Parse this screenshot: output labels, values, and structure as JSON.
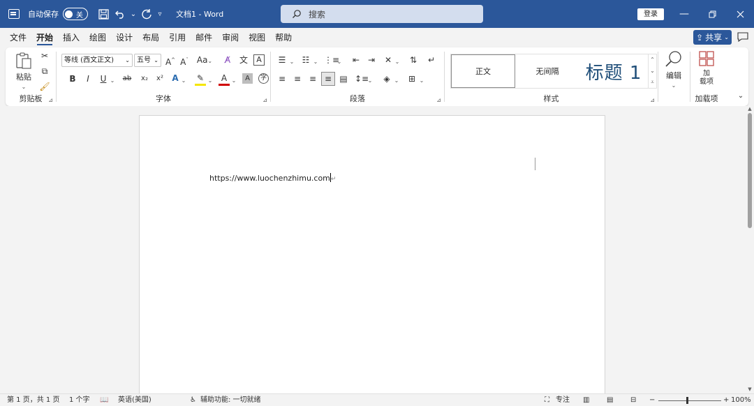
{
  "titlebar": {
    "autosave_label": "自动保存",
    "autosave_state": "关",
    "doc_title": "文档1  -  Word",
    "search_placeholder": "搜索",
    "login_label": "登录"
  },
  "menu": {
    "items": [
      "文件",
      "开始",
      "插入",
      "绘图",
      "设计",
      "布局",
      "引用",
      "邮件",
      "审阅",
      "视图",
      "帮助"
    ],
    "active": "开始",
    "share_label": "共享"
  },
  "ribbon": {
    "clipboard": {
      "paste_label": "粘贴",
      "group_label": "剪贴板"
    },
    "font": {
      "font_name": "等线 (西文正文)",
      "font_size": "五号",
      "group_label": "字体",
      "bold": "B",
      "italic": "I",
      "underline": "U",
      "strike": "ab",
      "subscript": "x₂",
      "superscript": "x²",
      "case": "Aa"
    },
    "paragraph": {
      "group_label": "段落"
    },
    "styles": {
      "items": [
        "正文",
        "无间隔",
        "标题 1"
      ],
      "selected": "正文",
      "group_label": "样式"
    },
    "editing": {
      "label": "编辑"
    },
    "addins": {
      "button_label_1": "加",
      "button_label_2": "载项",
      "group_label": "加载项"
    }
  },
  "document": {
    "text": "https://www.luochenzhimu.com"
  },
  "statusbar": {
    "page_info": "第 1 页，共 1 页",
    "word_count": "1 个字",
    "language": "英语(美国)",
    "accessibility": "辅助功能: 一切就绪",
    "focus_label": "专注",
    "zoom": "100%"
  }
}
